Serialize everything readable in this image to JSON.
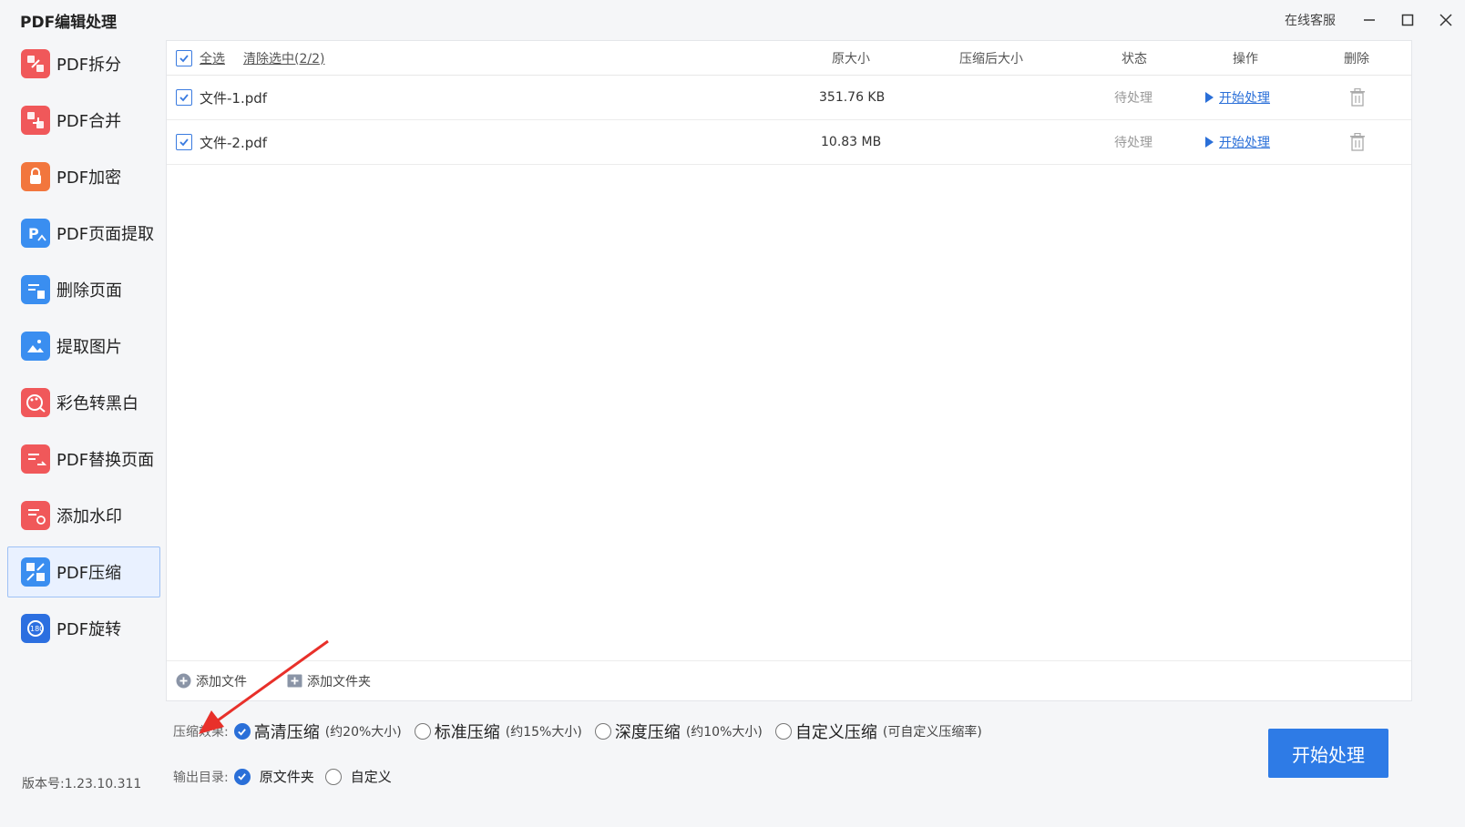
{
  "app": {
    "title": "PDF编辑处理"
  },
  "titlebar": {
    "online_service": "在线客服"
  },
  "sidebar": {
    "items": [
      {
        "label": "PDF拆分",
        "icon": "split-icon",
        "color": "#f0585a"
      },
      {
        "label": "PDF合并",
        "icon": "merge-icon",
        "color": "#f0585a"
      },
      {
        "label": "PDF加密",
        "icon": "lock-icon",
        "color": "#f2763d"
      },
      {
        "label": "PDF页面提取",
        "icon": "page-extract-icon",
        "color": "#3a8ef0"
      },
      {
        "label": "删除页面",
        "icon": "delete-page-icon",
        "color": "#3a8ef0"
      },
      {
        "label": "提取图片",
        "icon": "image-extract-icon",
        "color": "#3a8ef0"
      },
      {
        "label": "彩色转黑白",
        "icon": "palette-icon",
        "color": "#f0585a"
      },
      {
        "label": "PDF替换页面",
        "icon": "replace-page-icon",
        "color": "#f0585a"
      },
      {
        "label": "添加水印",
        "icon": "watermark-icon",
        "color": "#f0585a"
      },
      {
        "label": "PDF压缩",
        "icon": "compress-icon",
        "color": "#3a8ef0",
        "active": true
      },
      {
        "label": "PDF旋转",
        "icon": "rotate-icon",
        "color": "#2c6fe0"
      }
    ]
  },
  "version": "版本号:1.23.10.311",
  "table": {
    "select_all": "全选",
    "clear_selection": "清除选中(2/2)",
    "headers": {
      "original_size": "原大小",
      "compressed_size": "压缩后大小",
      "status": "状态",
      "action": "操作",
      "delete": "删除"
    },
    "rows": [
      {
        "name": "文件-1.pdf",
        "size": "351.76 KB",
        "compressed": "",
        "status": "待处理",
        "action": "开始处理",
        "checked": true
      },
      {
        "name": "文件-2.pdf",
        "size": "10.83 MB",
        "compressed": "",
        "status": "待处理",
        "action": "开始处理",
        "checked": true
      }
    ]
  },
  "footer": {
    "add_file": "添加文件",
    "add_folder": "添加文件夹"
  },
  "options": {
    "compress_label": "压缩效果:",
    "compress_modes": [
      {
        "label": "高清压缩",
        "note": "(约20%大小)",
        "selected": true
      },
      {
        "label": "标准压缩",
        "note": "(约15%大小)",
        "selected": false
      },
      {
        "label": "深度压缩",
        "note": "(约10%大小)",
        "selected": false
      },
      {
        "label": "自定义压缩",
        "note": "(可自定义压缩率)",
        "selected": false
      }
    ],
    "output_label": "输出目录:",
    "output_modes": [
      {
        "label": "原文件夹",
        "selected": true
      },
      {
        "label": "自定义",
        "selected": false
      }
    ]
  },
  "start_button": "开始处理",
  "colors": {
    "accent": "#2e7be6",
    "arrow": "#e8302a"
  }
}
